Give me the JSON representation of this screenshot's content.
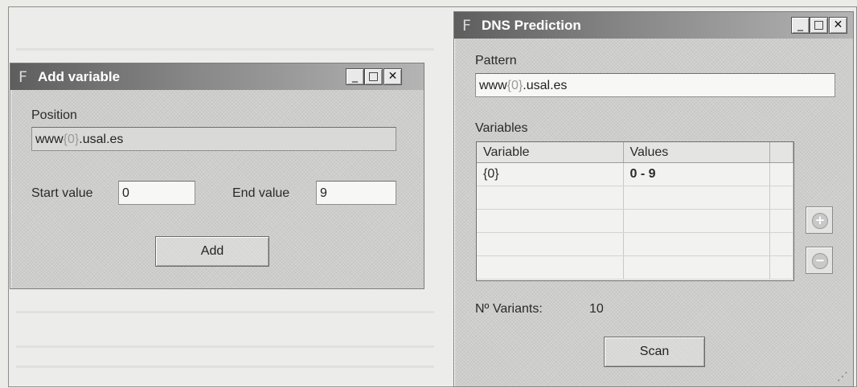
{
  "add_variable": {
    "title": "Add variable",
    "position_label": "Position",
    "position_value_prefix": "www",
    "position_value_token": "{0}",
    "position_value_suffix": ".usal.es",
    "start_label": "Start value",
    "start_value": "0",
    "end_label": "End value",
    "end_value": "9",
    "add_button": "Add"
  },
  "dns_prediction": {
    "title": "DNS Prediction",
    "pattern_label": "Pattern",
    "pattern_value_prefix": "www",
    "pattern_value_token": "{0}",
    "pattern_value_suffix": ".usal.es",
    "variables_label": "Variables",
    "columns": [
      "Variable",
      "Values"
    ],
    "rows": [
      {
        "variable": "{0}",
        "values": "0 - 9"
      }
    ],
    "variants_label": "Nº Variants:",
    "variants_value": "10",
    "scan_button": "Scan"
  },
  "window_controls": {
    "minimize": "_",
    "maximize": "□",
    "close": "✕"
  },
  "icons": {
    "app_icon_glyph": "F",
    "add_glyph": "+",
    "remove_glyph": "−",
    "grip_glyph": "⋰"
  }
}
